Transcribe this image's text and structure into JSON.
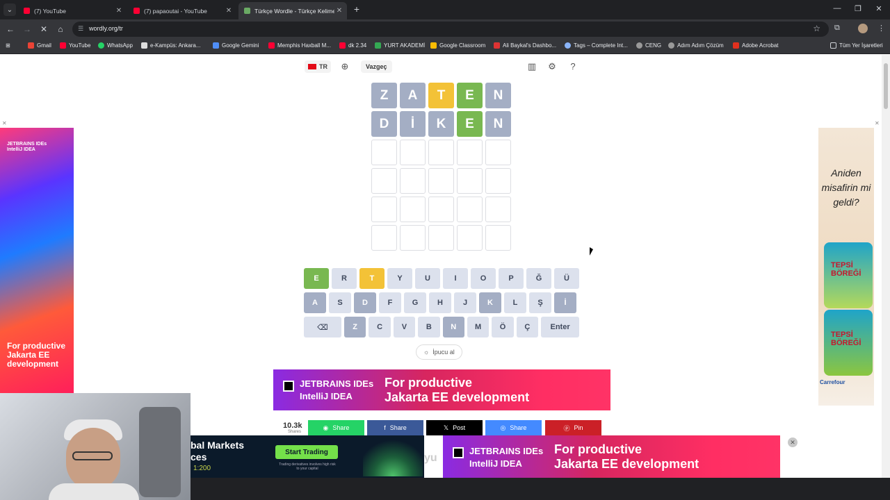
{
  "browser": {
    "tabs": [
      {
        "title": "(7) YouTube",
        "icon": "youtube-icon",
        "active": false
      },
      {
        "title": "(7) papaoutai - YouTube",
        "icon": "youtube-icon",
        "active": false
      },
      {
        "title": "Türkçe Wordle - Türkçe Kelime",
        "icon": "wordly-icon",
        "active": true
      }
    ],
    "url": "wordly.org/tr",
    "bookmarks": [
      "Gmail",
      "YouTube",
      "WhatsApp",
      "e-Kampüs: Ankara...",
      "Google Gemini",
      "Memphis Haxball M...",
      "dk 2.34",
      "YURT AKADEMİ",
      "Google Classroom",
      "Ali Baykal's Dashbo...",
      "Tags – Complete Int...",
      "CENG",
      "Adım Adım Çözüm",
      "Adobe Acrobat"
    ],
    "all_bookmarks": "Tüm Yer İşaretleri"
  },
  "game": {
    "language": "TR",
    "give_up": "Vazgeç",
    "hint": "İpucu al",
    "board": [
      [
        {
          "l": "Z",
          "s": "absent"
        },
        {
          "l": "A",
          "s": "absent"
        },
        {
          "l": "T",
          "s": "present"
        },
        {
          "l": "E",
          "s": "correct"
        },
        {
          "l": "N",
          "s": "absent"
        }
      ],
      [
        {
          "l": "D",
          "s": "absent"
        },
        {
          "l": "İ",
          "s": "absent"
        },
        {
          "l": "K",
          "s": "absent"
        },
        {
          "l": "E",
          "s": "correct"
        },
        {
          "l": "N",
          "s": "absent"
        }
      ],
      [
        {
          "l": "",
          "s": "empty"
        },
        {
          "l": "",
          "s": "empty"
        },
        {
          "l": "",
          "s": "empty"
        },
        {
          "l": "",
          "s": "empty"
        },
        {
          "l": "",
          "s": "empty"
        }
      ],
      [
        {
          "l": "",
          "s": "empty"
        },
        {
          "l": "",
          "s": "empty"
        },
        {
          "l": "",
          "s": "empty"
        },
        {
          "l": "",
          "s": "empty"
        },
        {
          "l": "",
          "s": "empty"
        }
      ],
      [
        {
          "l": "",
          "s": "empty"
        },
        {
          "l": "",
          "s": "empty"
        },
        {
          "l": "",
          "s": "empty"
        },
        {
          "l": "",
          "s": "empty"
        },
        {
          "l": "",
          "s": "empty"
        }
      ],
      [
        {
          "l": "",
          "s": "empty"
        },
        {
          "l": "",
          "s": "empty"
        },
        {
          "l": "",
          "s": "empty"
        },
        {
          "l": "",
          "s": "empty"
        },
        {
          "l": "",
          "s": "empty"
        }
      ]
    ],
    "keyboard": [
      [
        {
          "k": "E",
          "s": "correct"
        },
        {
          "k": "R",
          "s": ""
        },
        {
          "k": "T",
          "s": "present"
        },
        {
          "k": "Y",
          "s": ""
        },
        {
          "k": "U",
          "s": ""
        },
        {
          "k": "I",
          "s": ""
        },
        {
          "k": "O",
          "s": ""
        },
        {
          "k": "P",
          "s": ""
        },
        {
          "k": "Ğ",
          "s": ""
        },
        {
          "k": "Ü",
          "s": ""
        }
      ],
      [
        {
          "k": "A",
          "s": "absent"
        },
        {
          "k": "S",
          "s": ""
        },
        {
          "k": "D",
          "s": "absent"
        },
        {
          "k": "F",
          "s": ""
        },
        {
          "k": "G",
          "s": ""
        },
        {
          "k": "H",
          "s": ""
        },
        {
          "k": "J",
          "s": ""
        },
        {
          "k": "K",
          "s": "absent"
        },
        {
          "k": "L",
          "s": ""
        },
        {
          "k": "Ş",
          "s": ""
        },
        {
          "k": "İ",
          "s": "absent"
        }
      ],
      [
        {
          "k": "⌫",
          "s": "",
          "wide": true
        },
        {
          "k": "Z",
          "s": "absent"
        },
        {
          "k": "C",
          "s": ""
        },
        {
          "k": "V",
          "s": ""
        },
        {
          "k": "B",
          "s": ""
        },
        {
          "k": "N",
          "s": "absent"
        },
        {
          "k": "M",
          "s": ""
        },
        {
          "k": "Ö",
          "s": ""
        },
        {
          "k": "Ç",
          "s": ""
        },
        {
          "k": "Enter",
          "s": "",
          "enter": true
        }
      ]
    ]
  },
  "ads": {
    "jetbrains_brand": "JETBRAINS IDEs",
    "jetbrains_product": "IntelliJ IDEA",
    "jetbrains_line1": "For productive",
    "jetbrains_line2": "Jakarta EE development",
    "left_text": "For productive Jakarta EE development",
    "right_headline": "Aniden misafirin mi geldi?",
    "right_pack": "TEPSİ BÖREĞİ",
    "right_store": "Carrefour",
    "trade_title1": "bal Markets",
    "trade_title2": "ces",
    "trade_leverage": "1:200",
    "trade_cta": "Start Trading",
    "trade_risk": "Trading derivatives involves high risk to your capital"
  },
  "share": {
    "count": "10.3k",
    "count_label": "Shares",
    "buttons": [
      {
        "label": "Share",
        "color": "#25d366",
        "icon": "whatsapp-icon"
      },
      {
        "label": "Share",
        "color": "#3b5998",
        "icon": "facebook-icon"
      },
      {
        "label": "Post",
        "color": "#000000",
        "icon": "x-icon"
      },
      {
        "label": "Share",
        "color": "#448aff",
        "icon": "messenger-icon"
      },
      {
        "label": "Pin",
        "color": "#cb2027",
        "icon": "pinterest-icon"
      }
    ]
  },
  "colors": {
    "absent": "#a4aec4",
    "present": "#f3c237",
    "correct": "#79b851",
    "key": "#dce1ed"
  }
}
